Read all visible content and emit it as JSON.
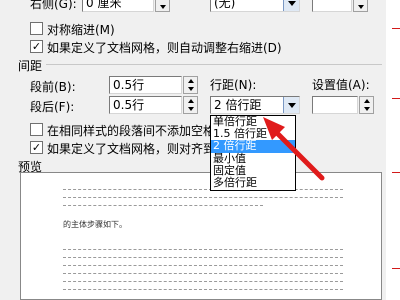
{
  "top_row": {
    "label": "右侧(G):",
    "value": "0 厘米",
    "special_value": "(无)"
  },
  "checkboxes": {
    "mirror_indent": {
      "label": "对称缩进(M)",
      "checked": false
    },
    "auto_adjust_indent": {
      "label": "如果定义了文档网格，则自动调整右缩进(D)",
      "checked": true
    },
    "no_space_same_style": {
      "label": "在相同样式的段落间不添加空格",
      "checked": false
    },
    "snap_to_grid": {
      "label": "如果定义了文档网格，则对齐到",
      "checked": true
    }
  },
  "spacing": {
    "section_title": "间距",
    "before_label": "段前(B):",
    "before_value": "0.5行",
    "after_label": "段后(F):",
    "after_value": "0.5行",
    "line_spacing_label": "行距(N):",
    "line_spacing_value": "2 倍行距",
    "set_value_label": "设置值(A):"
  },
  "line_spacing_options": [
    {
      "label": "单倍行距",
      "selected": false
    },
    {
      "label": "1.5 倍行距",
      "selected": false
    },
    {
      "label": "2 倍行距",
      "selected": true
    },
    {
      "label": "最小值",
      "selected": false
    },
    {
      "label": "固定值",
      "selected": false
    },
    {
      "label": "多倍行距",
      "selected": false
    }
  ],
  "preview": {
    "section_title": "预览",
    "sample_text": "的主体步骤如下。"
  },
  "accent_colors": {
    "selection": "#3399ff",
    "annotation_arrow": "#e01b1b"
  }
}
